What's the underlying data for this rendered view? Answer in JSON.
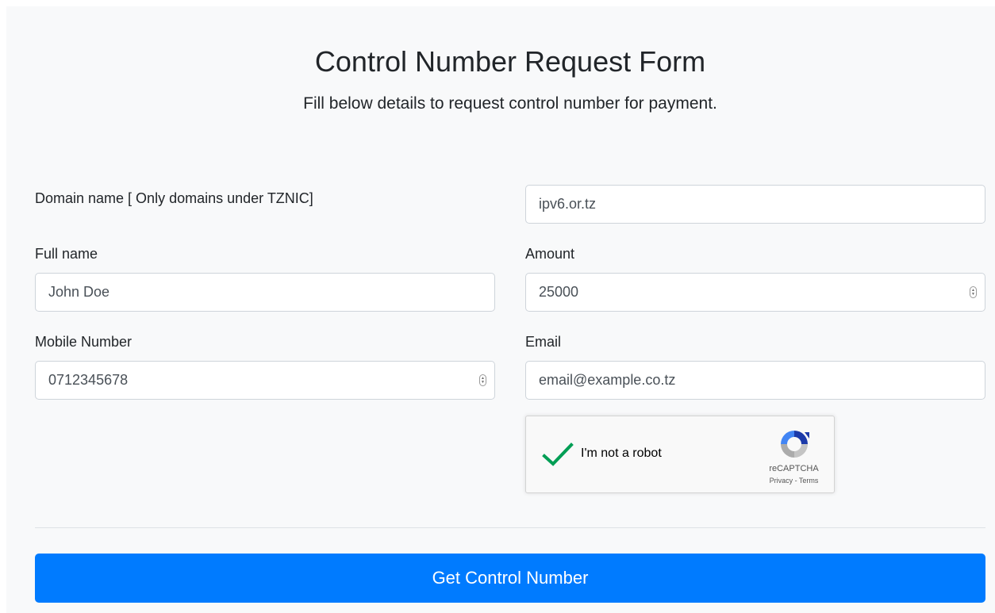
{
  "header": {
    "title": "Control Number Request Form",
    "subtitle": "Fill below details to request control number for payment."
  },
  "form": {
    "domain": {
      "label": "Domain name [ Only domains under TZNIC]",
      "value": "ipv6.or.tz"
    },
    "full_name": {
      "label": "Full name",
      "value": "John Doe"
    },
    "amount": {
      "label": "Amount",
      "value": "25000"
    },
    "mobile": {
      "label": "Mobile Number",
      "value": "0712345678"
    },
    "email": {
      "label": "Email",
      "value": "email@example.co.tz"
    }
  },
  "recaptcha": {
    "label": "I'm not a robot",
    "checked": true,
    "brand": "reCAPTCHA",
    "links": "Privacy - Terms",
    "check_icon": "checkmark-icon",
    "logo_icon": "recaptcha-logo-icon",
    "check_color": "#009e55"
  },
  "actions": {
    "submit_label": "Get Control Number"
  },
  "colors": {
    "primary": "#007bff",
    "panel_background": "#f8f9fa"
  }
}
